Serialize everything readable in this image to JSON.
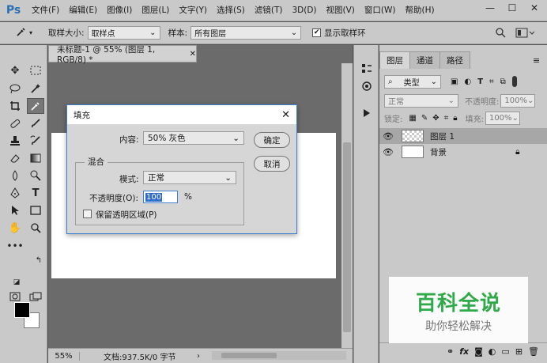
{
  "app": {
    "logo": "Ps"
  },
  "menu": [
    "文件(F)",
    "编辑(E)",
    "图像(I)",
    "图层(L)",
    "文字(Y)",
    "选择(S)",
    "滤镜(T)",
    "3D(D)",
    "视图(V)",
    "窗口(W)",
    "帮助(H)"
  ],
  "window_buttons": {
    "minimize": "—",
    "restore": "☐",
    "close": "✕"
  },
  "options": {
    "sample_size_label": "取样大小:",
    "sample_size_value": "取样点",
    "sample_label": "样本:",
    "sample_value": "所有图层",
    "show_ring_label": "显示取样环",
    "show_ring_checked": "✔"
  },
  "document": {
    "tab_title": "未标题-1 @ 55% (图层 1, RGB/8) *",
    "tab_close": "✕",
    "zoom": "55%",
    "status": "文档:937.5K/0 字节"
  },
  "dialog": {
    "title": "填充",
    "content_label": "内容:",
    "content_value": "50% 灰色",
    "ok_label": "确定",
    "cancel_label": "取消",
    "blend_group": "混合",
    "mode_label": "模式:",
    "mode_value": "正常",
    "opacity_label": "不透明度(O):",
    "opacity_value": "100",
    "opacity_unit": "%",
    "preserve_label": "保留透明区域(P)"
  },
  "layers_panel": {
    "tabs": [
      "图层",
      "通道",
      "路径"
    ],
    "filter_type": "类型",
    "blend_mode": "正常",
    "opacity_label": "不透明度:",
    "opacity_value": "100%",
    "lock_label": "锁定:",
    "fill_label": "填充:",
    "fill_value": "100%",
    "layers": [
      {
        "name": "图层 1"
      },
      {
        "name": "背景"
      }
    ]
  },
  "watermark": {
    "title": "百科全说",
    "subtitle": "助你轻松解决"
  },
  "colors": {
    "accent": "#3c7fcf",
    "watermark_green": "#2faa4a"
  }
}
